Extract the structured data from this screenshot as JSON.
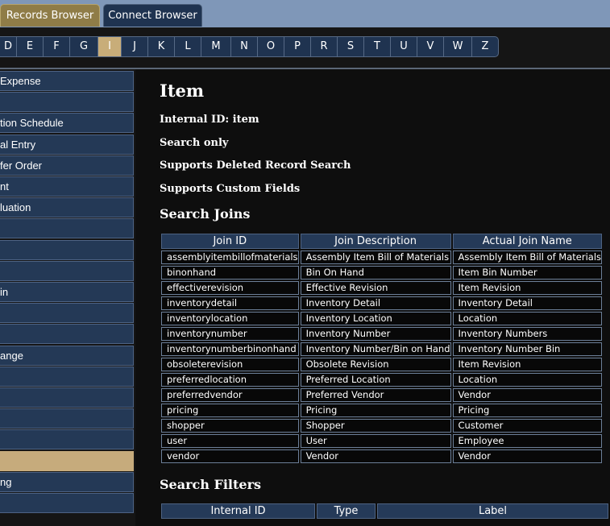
{
  "tabs": [
    {
      "label": "Records Browser",
      "active": true
    },
    {
      "label": "Connect Browser",
      "active": false
    }
  ],
  "letters": [
    "D",
    "E",
    "F",
    "G",
    "I",
    "J",
    "K",
    "L",
    "M",
    "N",
    "O",
    "P",
    "R",
    "S",
    "T",
    "U",
    "V",
    "W",
    "Z"
  ],
  "active_letter": "I",
  "sidebar": {
    "items": [
      "Expense",
      "",
      "tion Schedule",
      "al Entry",
      "fer Order",
      "nt",
      "luation",
      "",
      "",
      "",
      "in",
      "",
      "",
      "ange",
      "",
      "",
      "",
      "",
      "",
      "ng",
      ""
    ],
    "selected_index": 18
  },
  "record": {
    "title": "Item",
    "internal_id": "Internal ID: item",
    "search_only": "Search only",
    "deleted_search": "Supports Deleted Record Search",
    "custom_fields": "Supports Custom Fields"
  },
  "joins": {
    "heading": "Search Joins",
    "columns": [
      "Join ID",
      "Join Description",
      "Actual Join Name"
    ],
    "rows": [
      [
        "assemblyitembillofmaterials",
        "Assembly Item Bill of Materials",
        "Assembly Item Bill of Materials"
      ],
      [
        "binonhand",
        "Bin On Hand",
        "Item Bin Number"
      ],
      [
        "effectiverevision",
        "Effective Revision",
        "Item Revision"
      ],
      [
        "inventorydetail",
        "Inventory Detail",
        "Inventory Detail"
      ],
      [
        "inventorylocation",
        "Inventory Location",
        "Location"
      ],
      [
        "inventorynumber",
        "Inventory Number",
        "Inventory Numbers"
      ],
      [
        "inventorynumberbinonhand",
        "Inventory Number/Bin on Hand",
        "Inventory Number Bin"
      ],
      [
        "obsoleterevision",
        "Obsolete Revision",
        "Item Revision"
      ],
      [
        "preferredlocation",
        "Preferred Location",
        "Location"
      ],
      [
        "preferredvendor",
        "Preferred Vendor",
        "Vendor"
      ],
      [
        "pricing",
        "Pricing",
        "Pricing"
      ],
      [
        "shopper",
        "Shopper",
        "Customer"
      ],
      [
        "user",
        "User",
        "Employee"
      ],
      [
        "vendor",
        "Vendor",
        "Vendor"
      ]
    ]
  },
  "filters": {
    "heading": "Search Filters",
    "columns": [
      "Internal ID",
      "Type",
      "Label"
    ]
  }
}
